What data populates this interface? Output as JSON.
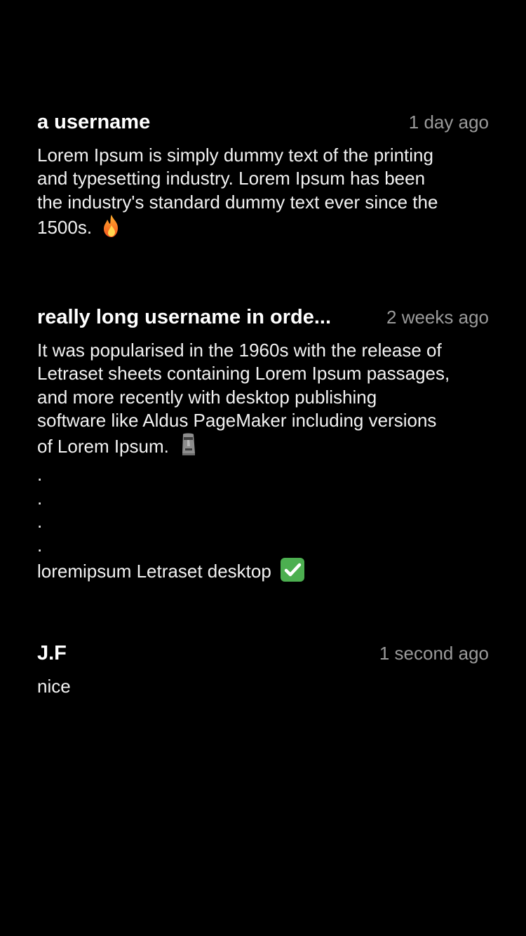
{
  "comments": [
    {
      "username": "a username",
      "time": "1 day ago",
      "lines": [
        "Lorem Ipsum is simply dummy text of the printing",
        "and typesetting industry. Lorem Ipsum has been",
        "the industry's standard dummy text ever since the",
        "1500s."
      ],
      "emoji": "fire-icon"
    },
    {
      "username": "really long username in orde...",
      "time": "2 weeks ago",
      "lines": [
        "It was popularised in the 1960s with the release of",
        "Letraset sheets containing Lorem Ipsum passages,",
        "and more recently with desktop publishing",
        "software like Aldus PageMaker including versions",
        "of Lorem Ipsum."
      ],
      "emoji": "moai-icon",
      "dots": [
        ".",
        ".",
        ".",
        "."
      ],
      "last_line": "loremipsum Letraset desktop",
      "last_emoji": "check-mark-button-icon"
    },
    {
      "username": "J.F",
      "time": "1 second ago",
      "lines": [
        "nice"
      ]
    }
  ]
}
